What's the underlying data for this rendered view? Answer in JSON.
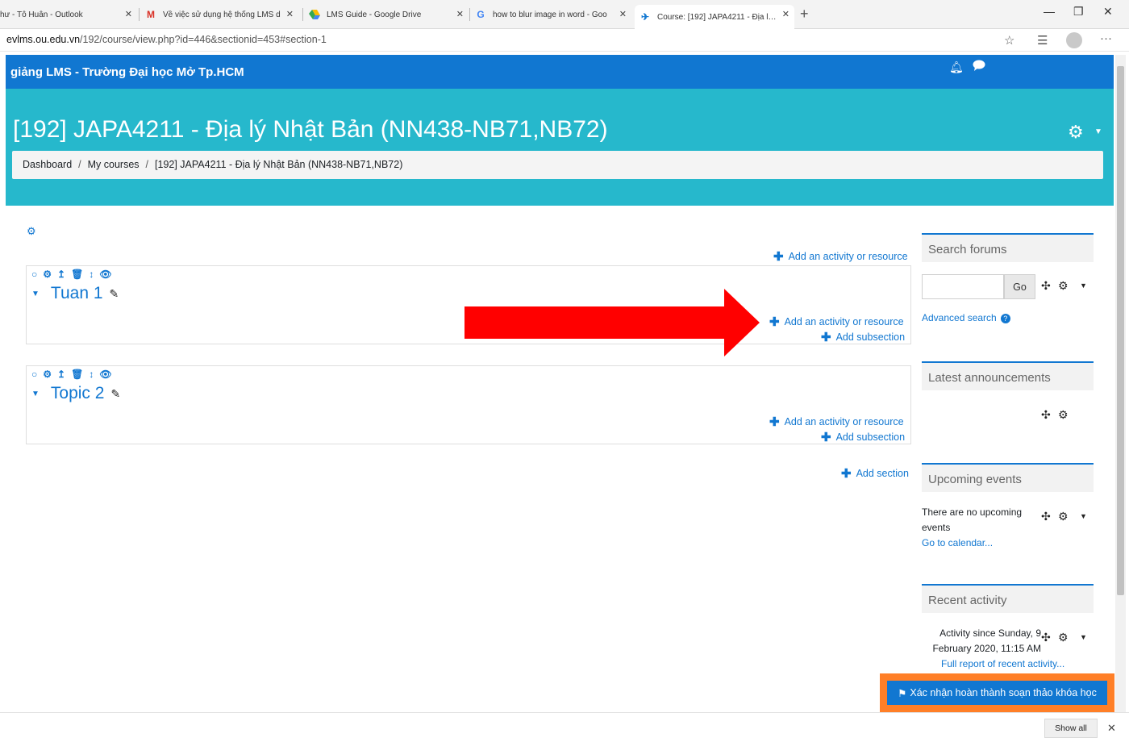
{
  "browser": {
    "tabs": [
      {
        "title": "hư - Tô Huân - Outlook",
        "icon": "outlook-icon"
      },
      {
        "title": "Về việc sử dụng hệ thống LMS d",
        "icon": "gmail-icon"
      },
      {
        "title": "LMS Guide - Google Drive",
        "icon": "drive-icon"
      },
      {
        "title": "how to blur image in word - Goo",
        "icon": "google-icon"
      },
      {
        "title": "Course: [192] JAPA4211 - Địa lý N",
        "icon": "moodle-icon"
      }
    ],
    "url_host": "evlms.ou.edu.vn",
    "url_path": "/192/course/view.php?id=446&sectionid=453#section-1"
  },
  "navbar": {
    "site_name": "giảng LMS - Trường Đại học Mở Tp.HCM"
  },
  "header": {
    "course_title": "[192] JAPA4211 - Địa lý Nhật Bản (NN438-NB71,NB72)",
    "breadcrumb": [
      "Dashboard",
      "My courses",
      "[192] JAPA4211 - Địa lý Nhật Bản (NN438-NB71,NB72)"
    ]
  },
  "course": {
    "add_activity_label": "Add an activity or resource",
    "add_subsection_label": "Add subsection",
    "add_section_label": "Add section",
    "sections": [
      {
        "name": "Tuan 1"
      },
      {
        "name": "Topic 2"
      }
    ]
  },
  "blocks": {
    "search_forums": {
      "title": "Search forums",
      "go_label": "Go",
      "advanced_search": "Advanced search"
    },
    "latest_announcements": {
      "title": "Latest announcements"
    },
    "upcoming_events": {
      "title": "Upcoming events",
      "empty_text": "There are no upcoming events",
      "calendar_link": "Go to calendar..."
    },
    "recent_activity": {
      "title": "Recent activity",
      "since_text": "Activity since Sunday, 9 February 2020, 11:15 AM",
      "full_report_link": "Full report of recent activity..."
    }
  },
  "confirm_button": {
    "label": "Xác nhận hoàn thành soạn thảo khóa học"
  },
  "downloads_bar": {
    "show_all": "Show all"
  },
  "colors": {
    "primary": "#1177d1",
    "header": "#26b8cc",
    "highlight": "#ff7f27",
    "arrow": "#ff0000"
  }
}
